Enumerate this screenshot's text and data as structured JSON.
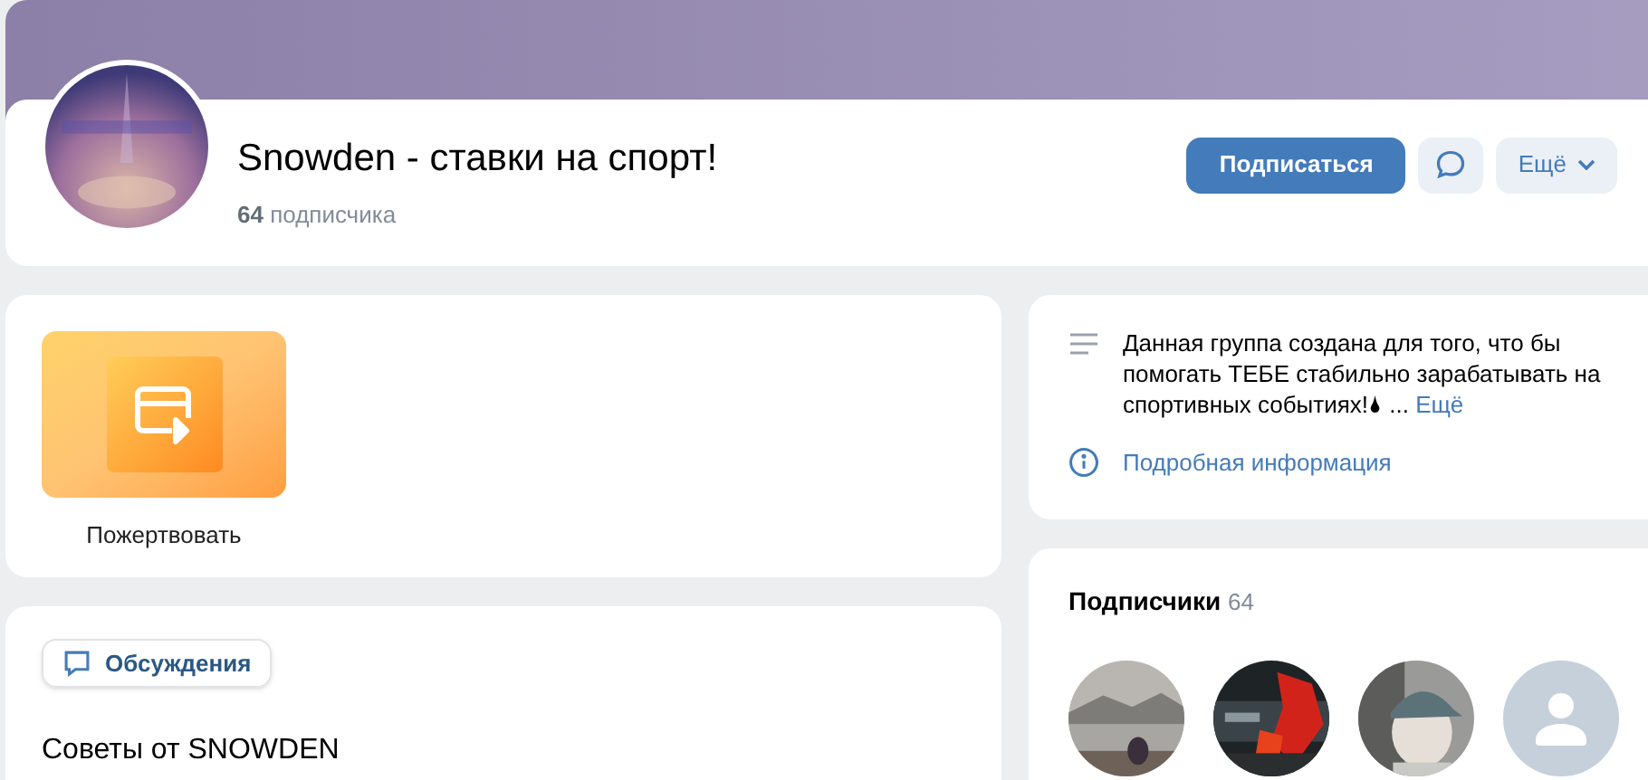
{
  "group": {
    "title": "Snowden - ставки на спорт!",
    "subscribers_count": "64",
    "subscribers_label": "подписчика",
    "avatar": {
      "kind": "picture"
    }
  },
  "actions": {
    "subscribe": "Подписаться",
    "more": "Ещё"
  },
  "donate": {
    "label": "Пожертвовать"
  },
  "discussions": {
    "tab": "Обсуждения",
    "topics": [
      {
        "title": "Советы от SNOWDEN"
      }
    ]
  },
  "about": {
    "description": "Данная группа создана для того, что бы помогать ТЕБЕ стабильно зарабатывать на спортивных событиях!🌢",
    "ellipsis": "...",
    "more_link": "Ещё",
    "details_link": "Подробная информация"
  },
  "subscribers": {
    "title": "Подписчики",
    "count": "64",
    "avatars": [
      {
        "kind": "picture"
      },
      {
        "kind": "picture"
      },
      {
        "kind": "picture"
      },
      {
        "kind": "placeholder"
      }
    ]
  }
}
